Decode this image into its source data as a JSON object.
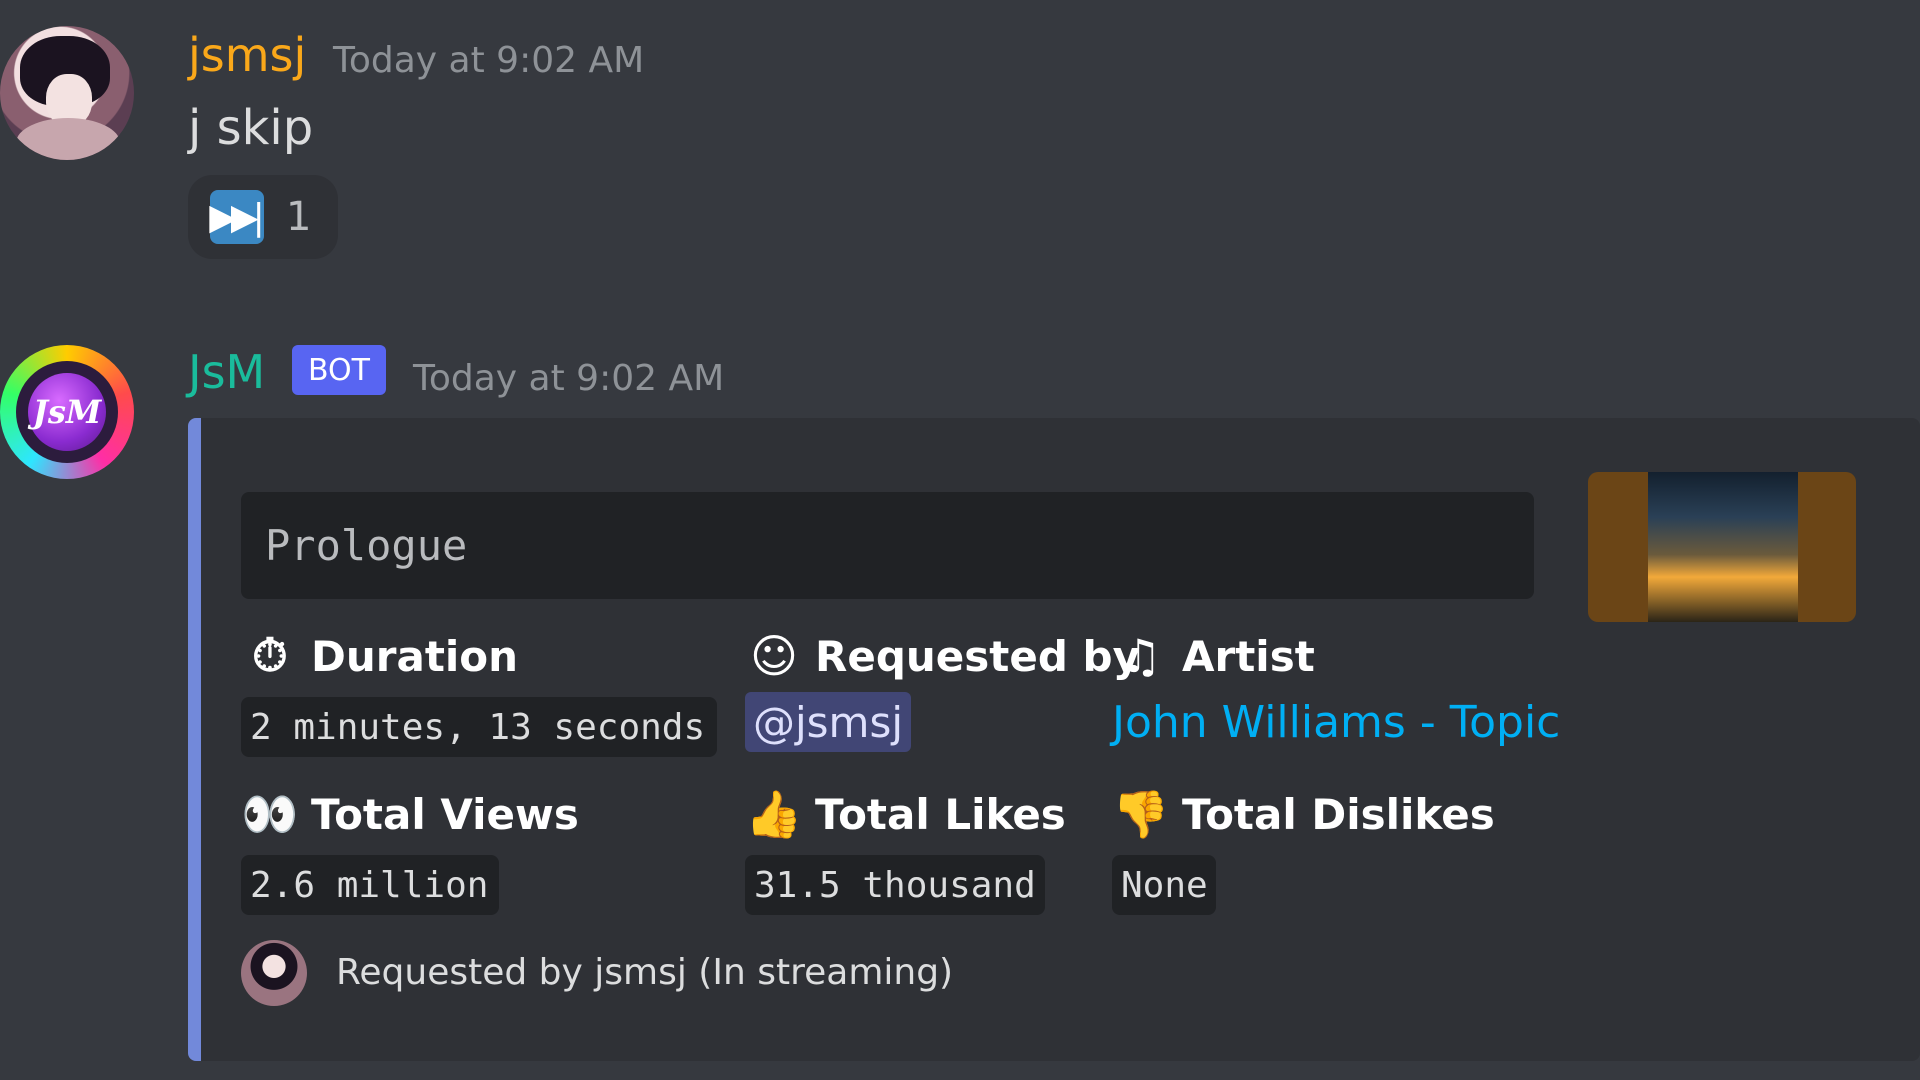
{
  "messages": [
    {
      "author": "jsmsj",
      "author_color": "#faa81a",
      "timestamp": "Today at 9:02 AM",
      "text": "j skip",
      "reaction": {
        "emoji": "next-track-icon",
        "count": "1"
      }
    },
    {
      "author": "JsM",
      "author_color": "#1abc9c",
      "badge": "BOT",
      "timestamp": "Today at 9:02 AM",
      "avatar_text": "JsM",
      "embed": {
        "accent_color": "#7289da",
        "description": "Prologue",
        "fields": [
          {
            "icon": "stopwatch-icon",
            "name": "Duration",
            "value": "2 minutes, 13 seconds"
          },
          {
            "icon": "person-icon",
            "name": "Requested by",
            "value": "@jsmsj"
          },
          {
            "icon": "artist-icon",
            "name": "Artist",
            "value": "John Williams - Topic"
          },
          {
            "icon": "eyes-icon",
            "name": "Total Views",
            "value": "2.6 million"
          },
          {
            "icon": "thumbs-up-icon",
            "name": "Total Likes",
            "value": "31.5 thousand"
          },
          {
            "icon": "thumbs-down-icon",
            "name": "Total Dislikes",
            "value": "None"
          }
        ],
        "footer": "Requested by jsmsj (In streaming)"
      }
    }
  ]
}
